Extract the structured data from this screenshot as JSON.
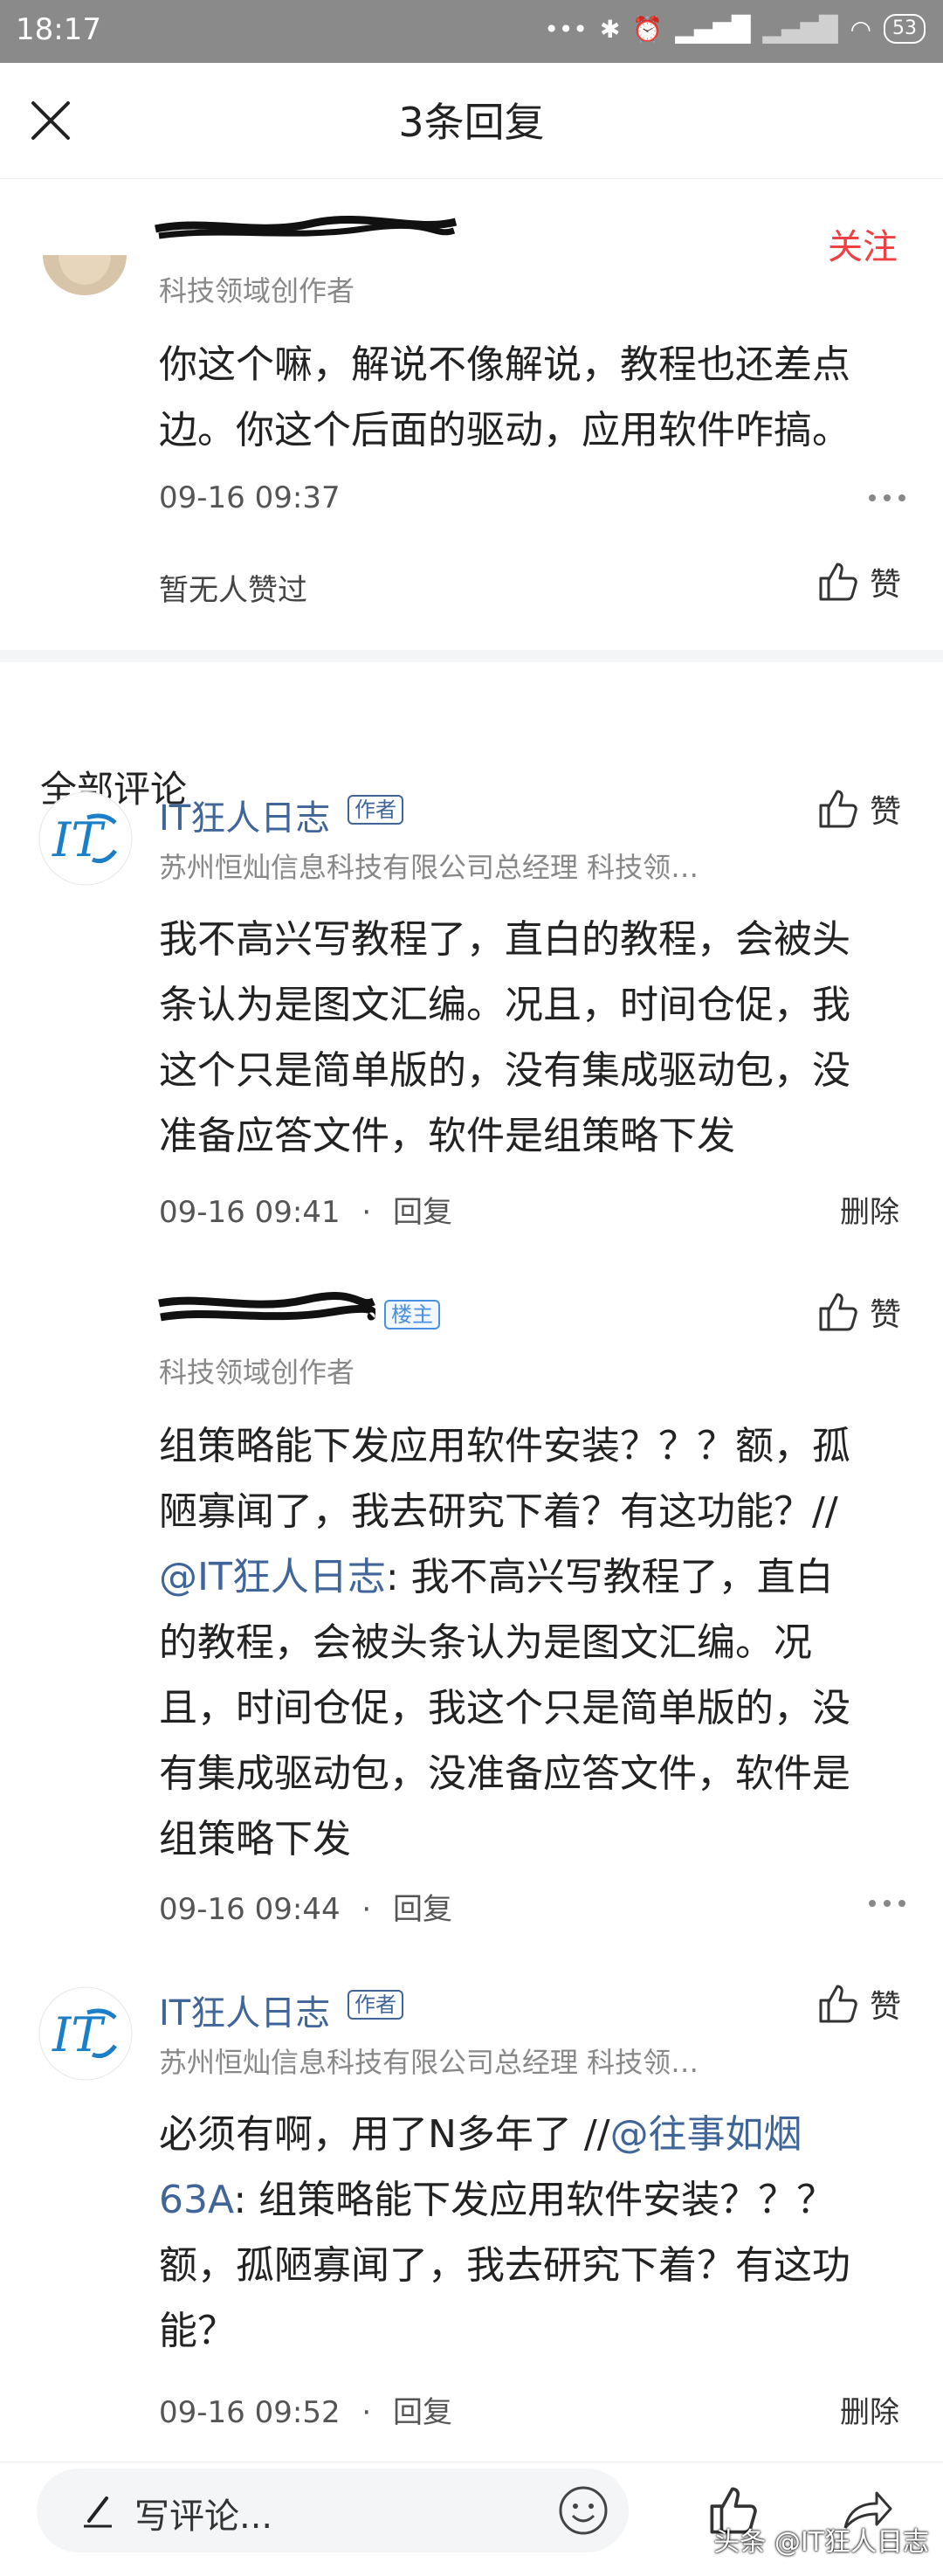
{
  "status_bar": {
    "time": "18:17",
    "battery": "53"
  },
  "header": {
    "title": "3条回复"
  },
  "original_comment": {
    "follow_label": "关注",
    "role": "科技领域创作者",
    "lines": [
      "你这个嘛，解说不像解说，教程也还差点",
      "边。你这个后面的驱动，应用软件咋搞。"
    ],
    "time": "09-16 09:37",
    "no_likes": "暂无人赞过",
    "like_label": "赞"
  },
  "section_title": "全部评论",
  "comments": [
    {
      "name": "IT狂人日志",
      "tag": "作者",
      "subtitle": "苏州恒灿信息科技有限公司总经理 科技领…",
      "lines": [
        "我不高兴写教程了，直白的教程，会被头",
        "条认为是图文汇编。况且，时间仓促，我",
        "这个只是简单版的，没有集成驱动包，没",
        "准备应答文件，软件是组策略下发"
      ],
      "time": "09-16 09:41",
      "dot": "·",
      "reply_label": "回复",
      "delete_label": "删除",
      "like_label": "赞"
    },
    {
      "tag": "楼主",
      "subtitle": "科技领域创作者",
      "lines": [
        "组策略能下发应用软件安装？？？额，孤",
        "陋寡闻了，我去研究下着？有这功能？//"
      ],
      "mention": "@IT狂人日志",
      "quote_first": ": 我不高兴写教程了，直白",
      "quote_lines": [
        "的教程，会被头条认为是图文汇编。况",
        "且，时间仓促，我这个只是简单版的，没",
        "有集成驱动包，没准备应答文件，软件是",
        "组策略下发"
      ],
      "time": "09-16 09:44",
      "dot": "·",
      "reply_label": "回复",
      "like_label": "赞"
    },
    {
      "name": "IT狂人日志",
      "tag": "作者",
      "subtitle": "苏州恒灿信息科技有限公司总经理 科技领…",
      "line1_prefix": "必须有啊，用了N多年了 //",
      "mention_a": "@往事如烟",
      "mention_b": "63A",
      "line2_rest": ": 组策略能下发应用软件安装？？？",
      "lines_rest": [
        "额，孤陋寡闻了，我去研究下着？有这功",
        "能？"
      ],
      "time": "09-16 09:52",
      "dot": "·",
      "reply_label": "回复",
      "delete_label": "删除",
      "like_label": "赞"
    }
  ],
  "bottom_bar": {
    "placeholder": "写评论...",
    "watermark": "头条 @IT狂人日志"
  },
  "colors": {
    "link": "#406599",
    "follow": "#f04142",
    "muted": "#888888"
  }
}
